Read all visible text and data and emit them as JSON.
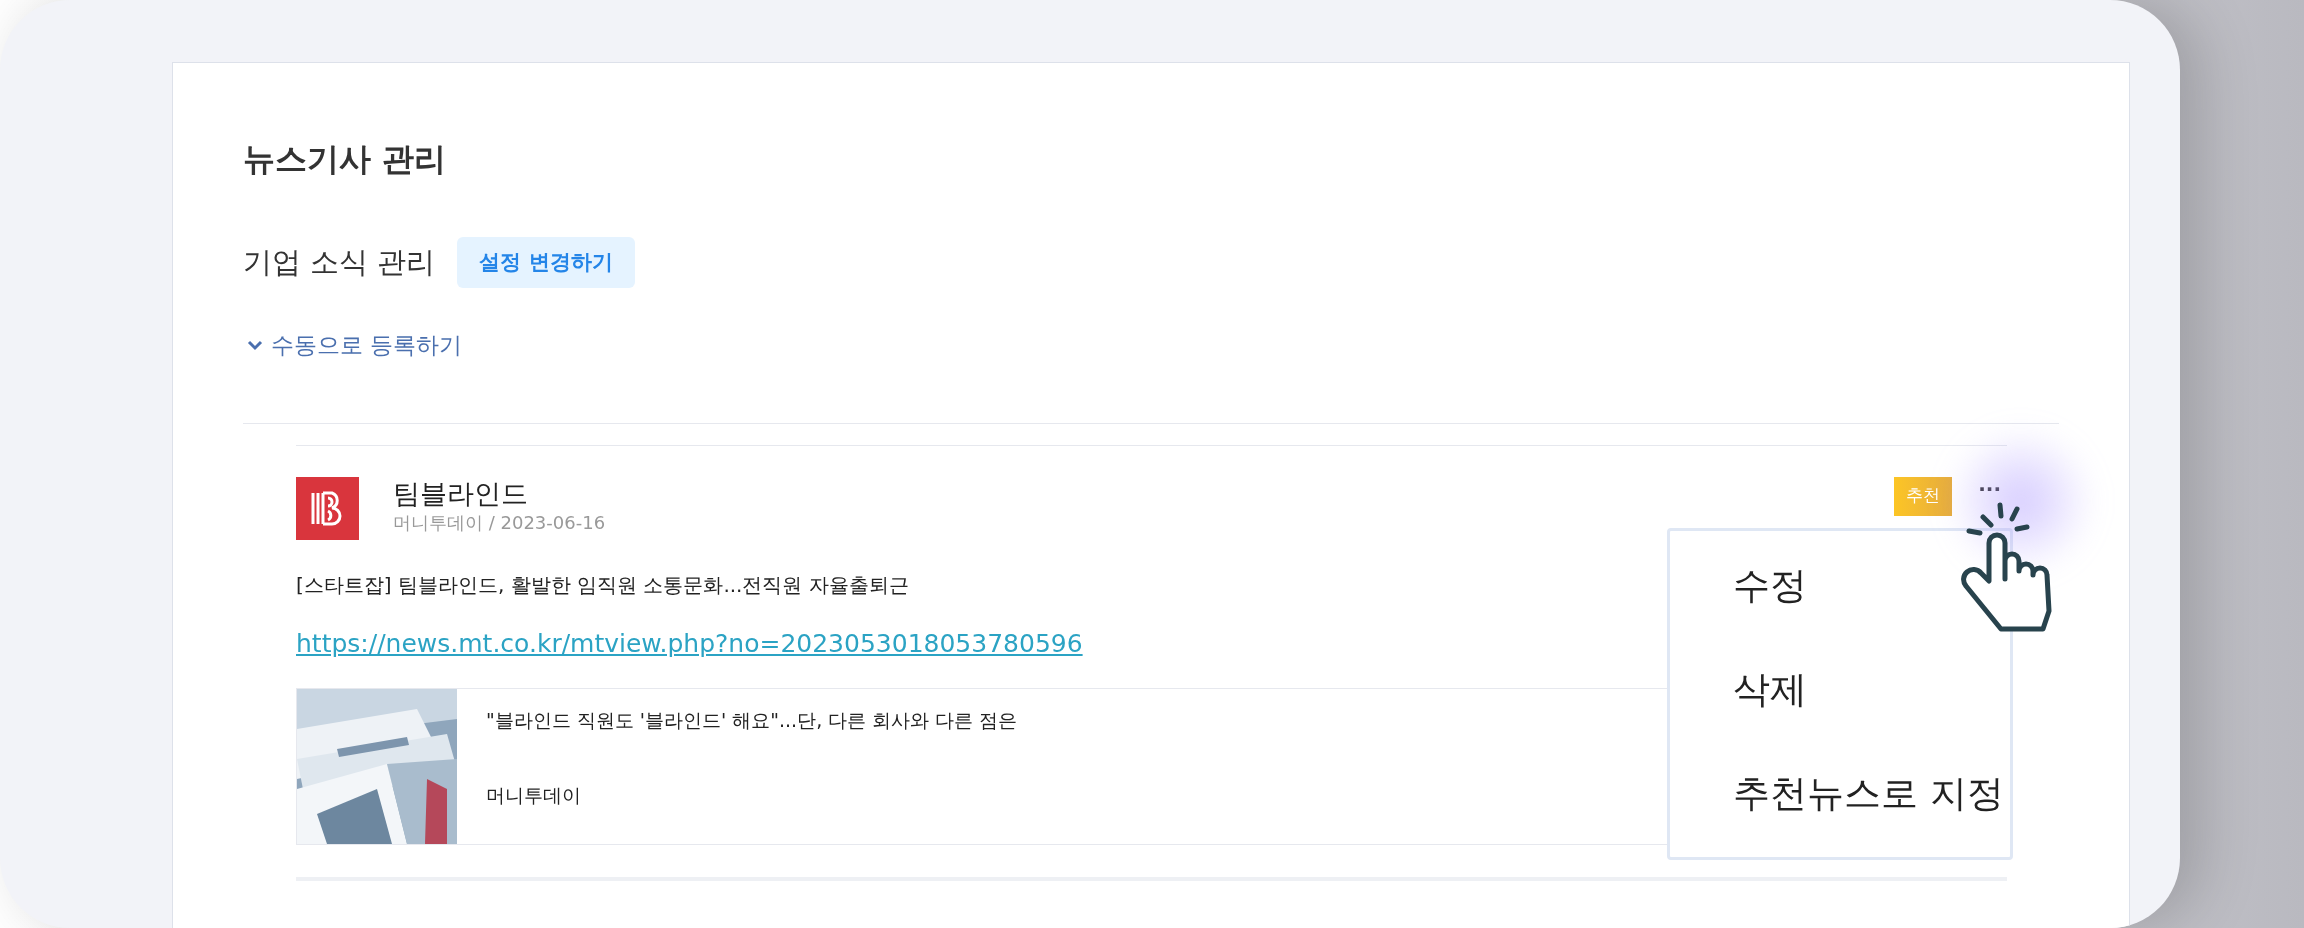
{
  "page": {
    "title": "뉴스기사 관리"
  },
  "section": {
    "label": "기업 소식 관리",
    "button": "설정 변경하기"
  },
  "manual_toggle": {
    "label": "수동으로 등록하기",
    "expanded": true
  },
  "news_item": {
    "company": "팀블라인드",
    "meta": "머니투데이 / 2023-06-16",
    "badge": "추천",
    "more": "...",
    "headline": "[스타트잡] 팀블라인드, 활발한 임직원 소통문화...전직원 자율출퇴근",
    "url": "https://news.mt.co.kr/mtview.php?no=2023053018053780596",
    "preview": {
      "title": "\"블라인드 직원도 '블라인드' 해요\"...단, 다른 회사와 다른 점은",
      "source": "머니투데이"
    }
  },
  "menu": {
    "open": true,
    "items": [
      {
        "label": "수정"
      },
      {
        "label": "삭제"
      },
      {
        "label": "추천뉴스로 지정"
      }
    ]
  }
}
